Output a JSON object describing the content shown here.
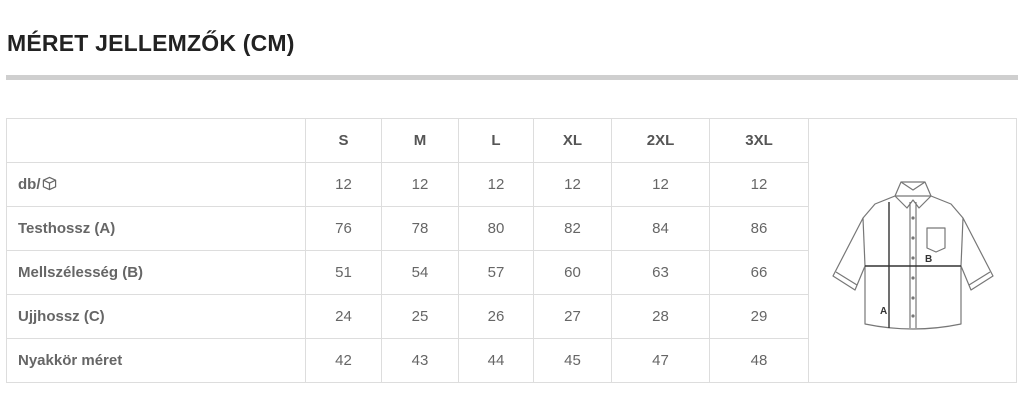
{
  "title": "MÉRET JELLEMZŐK (CM)",
  "table": {
    "sizes": [
      "S",
      "M",
      "L",
      "XL",
      "2XL",
      "3XL"
    ],
    "rows": [
      {
        "label": "db/",
        "icon": "box-icon",
        "values": [
          "12",
          "12",
          "12",
          "12",
          "12",
          "12"
        ]
      },
      {
        "label": "Testhossz (A)",
        "values": [
          "76",
          "78",
          "80",
          "82",
          "84",
          "86"
        ]
      },
      {
        "label": "Mellszélesség (B)",
        "values": [
          "51",
          "54",
          "57",
          "60",
          "63",
          "66"
        ]
      },
      {
        "label": "Ujjhossz (C)",
        "values": [
          "24",
          "25",
          "26",
          "27",
          "28",
          "29"
        ]
      },
      {
        "label": "Nyakkör méret",
        "values": [
          "42",
          "43",
          "44",
          "45",
          "47",
          "48"
        ]
      }
    ]
  },
  "diagram": {
    "label_a": "A",
    "label_b": "B"
  }
}
